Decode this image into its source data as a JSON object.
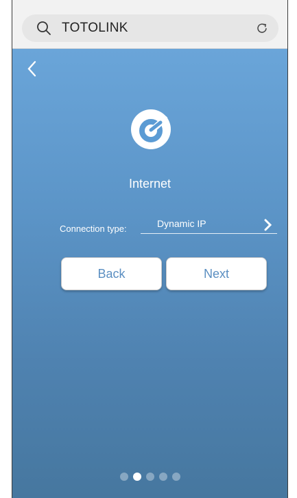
{
  "browser": {
    "search_text": "TOTOLINK"
  },
  "screen": {
    "title": "Internet",
    "connection_label": "Connection type:",
    "connection_value": "Dynamic IP",
    "buttons": {
      "back": "Back",
      "next": "Next"
    },
    "pagination": {
      "total": 5,
      "active_index": 1
    }
  },
  "colors": {
    "gradient_top": "#6aa5d9",
    "gradient_bottom": "#46779f",
    "button_text": "#5a8ec1"
  },
  "icons": [
    "search-icon",
    "refresh-icon",
    "back-chevron-icon",
    "totolink-logo-icon",
    "chevron-right-icon"
  ]
}
